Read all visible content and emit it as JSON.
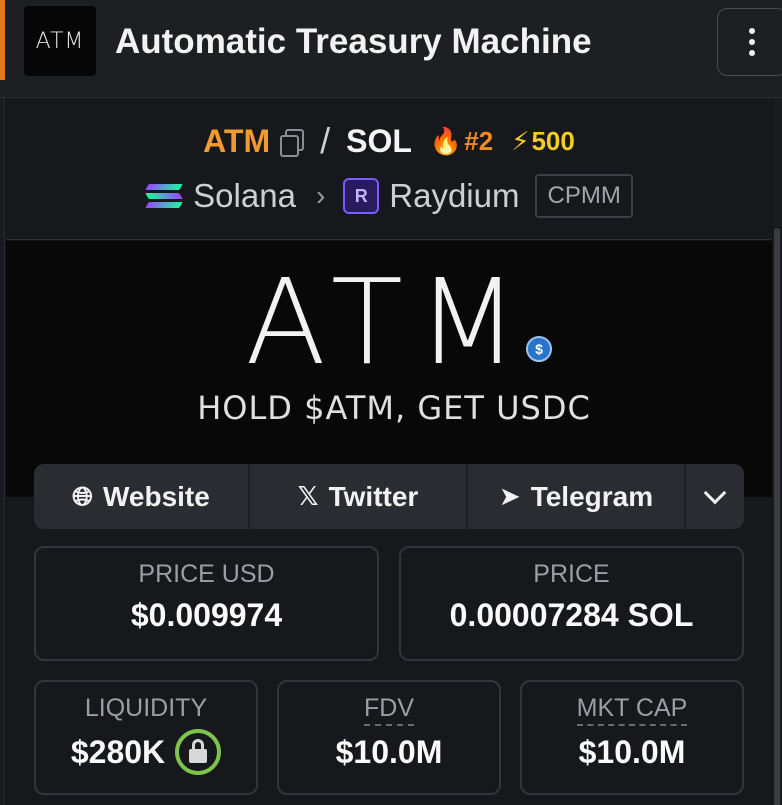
{
  "header": {
    "logo_text": "ATM",
    "title": "Automatic Treasury Machine"
  },
  "pair": {
    "base": "ATM",
    "separator": "/",
    "quote": "SOL",
    "rank": "#2",
    "boosts": "500"
  },
  "chain": {
    "name": "Solana",
    "dex": "Raydium",
    "dex_icon_letter": "R",
    "pool_type": "CPMM"
  },
  "banner": {
    "title": "ATM",
    "tagline": "HOLD $ATM, GET USDC",
    "coin_symbol": "$"
  },
  "links": {
    "website": "Website",
    "twitter": "Twitter",
    "telegram": "Telegram"
  },
  "stats": {
    "price_usd_label": "PRICE USD",
    "price_usd": "$0.009974",
    "price_label": "PRICE",
    "price_native": "0.00007284 SOL",
    "liquidity_label": "LIQUIDITY",
    "liquidity": "$280K",
    "fdv_label": "FDV",
    "fdv": "$10.0M",
    "mcap_label": "MKT CAP",
    "mcap": "$10.0M"
  },
  "colors": {
    "accent_orange": "#f29a2e",
    "boost_yellow": "#f3cd25",
    "lock_green": "#7ec44b"
  }
}
